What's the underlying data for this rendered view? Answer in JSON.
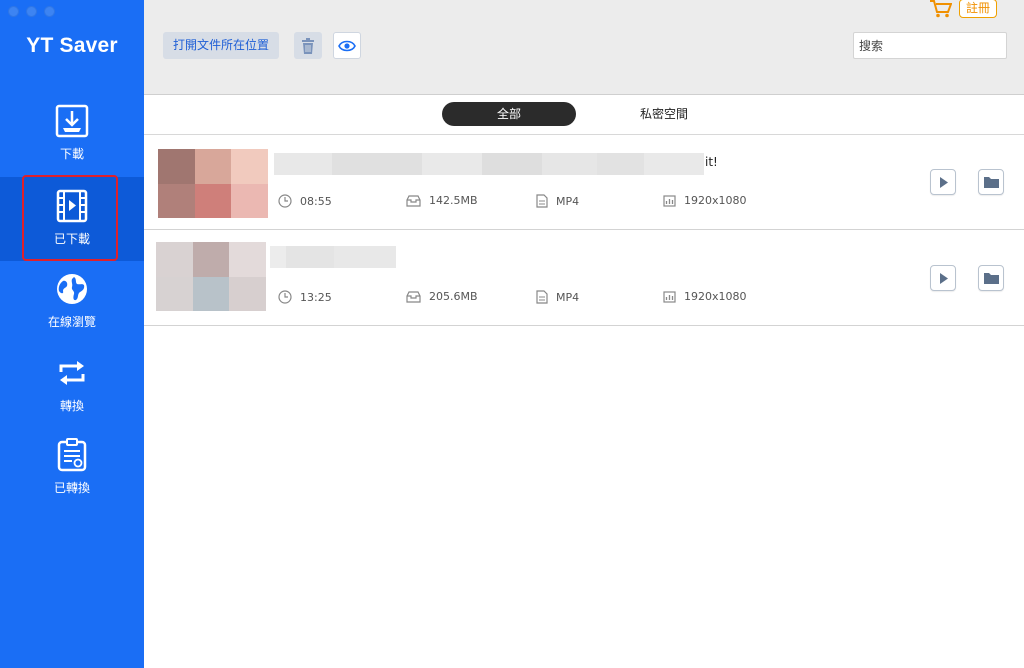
{
  "app": {
    "title": "YT Saver"
  },
  "sidebar": {
    "items": [
      {
        "label": "下載",
        "icon": "download-icon",
        "active": false
      },
      {
        "label": "已下載",
        "icon": "film-icon",
        "active": true
      },
      {
        "label": "在線瀏覽",
        "icon": "globe-icon",
        "active": false
      },
      {
        "label": "轉換",
        "icon": "convert-icon",
        "active": false
      },
      {
        "label": "已轉換",
        "icon": "converted-icon",
        "active": false
      }
    ]
  },
  "toolbar": {
    "open_location_label": "打開文件所在位置",
    "trash_icon": "trash-icon",
    "eye_icon": "eye-icon",
    "search_placeholder": "搜索",
    "register_label": "註冊",
    "cart_icon": "cart-icon"
  },
  "tabs": [
    {
      "label": "全部",
      "active": true
    },
    {
      "label": "私密空間",
      "active": false
    }
  ],
  "downloads": [
    {
      "title_tail": "it!",
      "duration": "08:55",
      "size": "142.5MB",
      "format": "MP4",
      "resolution": "1920x1080",
      "thumb_colors": [
        "#a07670",
        "#d8a79a",
        "#f1cabe",
        "#b0807a",
        "#cf7f7a",
        "#ebb8b2"
      ]
    },
    {
      "title_tail": "",
      "duration": "13:25",
      "size": "205.6MB",
      "format": "MP4",
      "resolution": "1920x1080",
      "thumb_colors": [
        "#d9d2d2",
        "#bfacab",
        "#e3dada",
        "#d7d2d2",
        "#b8c2c9",
        "#d7cfcf"
      ]
    }
  ],
  "colors": {
    "accent": "#1a6ef5",
    "active_nav": "#0d5ad8",
    "highlight": "#e0202a",
    "register": "#f09000"
  }
}
